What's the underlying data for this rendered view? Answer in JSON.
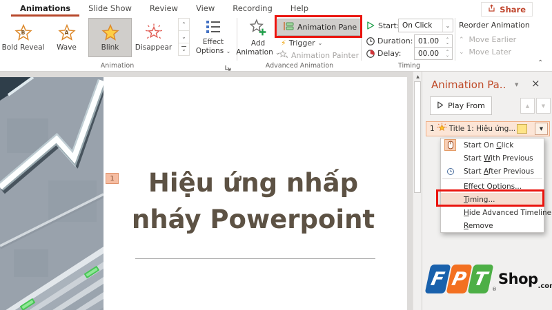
{
  "ribbon": {
    "tabs": [
      "Animations",
      "Slide Show",
      "Review",
      "View",
      "Recording",
      "Help"
    ],
    "share_label": "Share",
    "gallery": [
      {
        "label": "Bold Reveal",
        "letter": "B"
      },
      {
        "label": "Wave",
        "letter": "A"
      },
      {
        "label": "Blink",
        "letter": ""
      },
      {
        "label": "Disappear",
        "letter": ""
      }
    ],
    "effect_options": {
      "line1": "Effect",
      "line2": "Options"
    },
    "add_animation": {
      "line1": "Add",
      "line2": "Animation"
    },
    "advanced": {
      "animation_pane": "Animation Pane",
      "trigger": "Trigger",
      "animation_painter": "Animation Painter"
    },
    "timing": {
      "start_label": "Start:",
      "start_value": "On Click",
      "duration_label": "Duration:",
      "duration_value": "01.00",
      "delay_label": "Delay:",
      "delay_value": "00.00"
    },
    "reorder": {
      "title": "Reorder Animation",
      "move_earlier": "Move Earlier",
      "move_later": "Move Later"
    },
    "group_labels": {
      "animation": "Animation",
      "advanced": "Advanced Animation",
      "timing": "Timing"
    }
  },
  "slide": {
    "number_badge": "1",
    "title_line1": "Hiệu ứng nhấp",
    "title_line2": "nháy Powerpoint"
  },
  "pane": {
    "title": "Animation Pa..",
    "play_from": "Play From",
    "item": {
      "index": "1",
      "label": "Title 1: Hiệu ứng..."
    },
    "menu": [
      {
        "pre": "Start On ",
        "key": "C",
        "post": "lick"
      },
      {
        "pre": "Start ",
        "key": "W",
        "post": "ith Previous"
      },
      {
        "pre": "Start ",
        "key": "A",
        "post": "fter Previous"
      },
      {
        "pre": "",
        "key": "E",
        "post": "ffect Options..."
      },
      {
        "pre": "",
        "key": "T",
        "post": "iming..."
      },
      {
        "pre": "",
        "key": "H",
        "post": "ide Advanced Timeline"
      },
      {
        "pre": "",
        "key": "R",
        "post": "emove"
      }
    ]
  },
  "watermark": {
    "f": "F",
    "p": "P",
    "t": "T",
    "reg": "®",
    "shop": "Shop",
    "domain": ".com.vn"
  },
  "icons": {
    "chevron_down": "⌄",
    "chevron_up": "⌃",
    "triangle_down": "▼",
    "triangle_up_small": "▲",
    "triangle_down_small": "▼",
    "close": "×",
    "lightning": "⚡"
  },
  "colors": {
    "accent_red": "#b7472a",
    "annotation_red": "#ea140e",
    "selection_fill": "#fce5d6",
    "timeline_yellow": "#fee487",
    "title_brown": "#5d5244",
    "fpt_blue": "#1961ac",
    "fpt_orange": "#f37021",
    "fpt_green": "#4daf46"
  }
}
